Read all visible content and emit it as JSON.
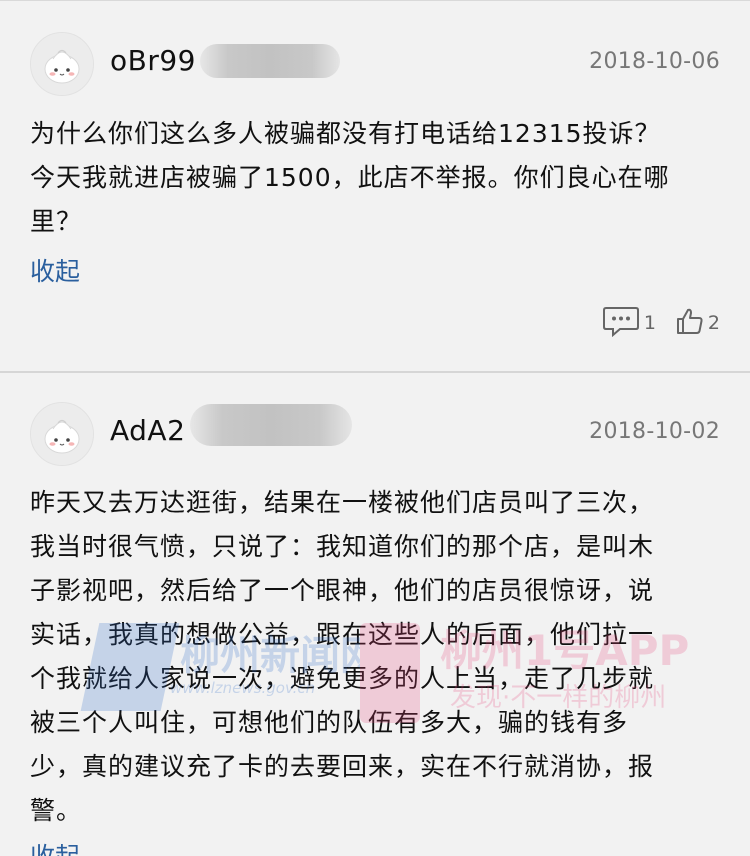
{
  "comments": [
    {
      "username": "oBr99",
      "date": "2018-10-06",
      "lines": [
        "为什么你们这么多人被骗都没有打电话给12315投诉？",
        "今天我就进店被骗了1500，此店不举报。你们良心在哪",
        "里？"
      ],
      "collapse_label": "收起",
      "reply_count": "1",
      "like_count": "2",
      "avatar_icon": "bun-avatar-icon",
      "reply_icon": "comment-bubble-icon",
      "like_icon": "thumbs-up-icon"
    },
    {
      "username": "AdA2",
      "date": "2018-10-02",
      "lines": [
        "昨天又去万达逛街，结果在一楼被他们店员叫了三次，",
        "我当时很气愤，只说了：我知道你们的那个店，是叫木",
        "子影视吧，然后给了一个眼神，他们的店员很惊讶，说",
        "实话，我真的想做公益，跟在这些人的后面，他们拉一",
        "个我就给人家说一次，避免更多的人上当，走了几步就",
        "被三个人叫住，可想他们的队伍有多大，骗的钱有多",
        "少，真的建议充了卡的去要回来，实在不行就消协，报",
        "警。"
      ],
      "collapse_label": "收起",
      "avatar_icon": "bun-avatar-icon"
    }
  ],
  "watermark": {
    "site_name": "柳州新闻网",
    "site_url": "www.lznews.gov.cn",
    "app_name": "柳州1号APP",
    "app_slogan": "发现·不一样的柳州"
  },
  "colors": {
    "background": "#f2f2f2",
    "link": "#2a5f9e",
    "date": "#777777"
  }
}
